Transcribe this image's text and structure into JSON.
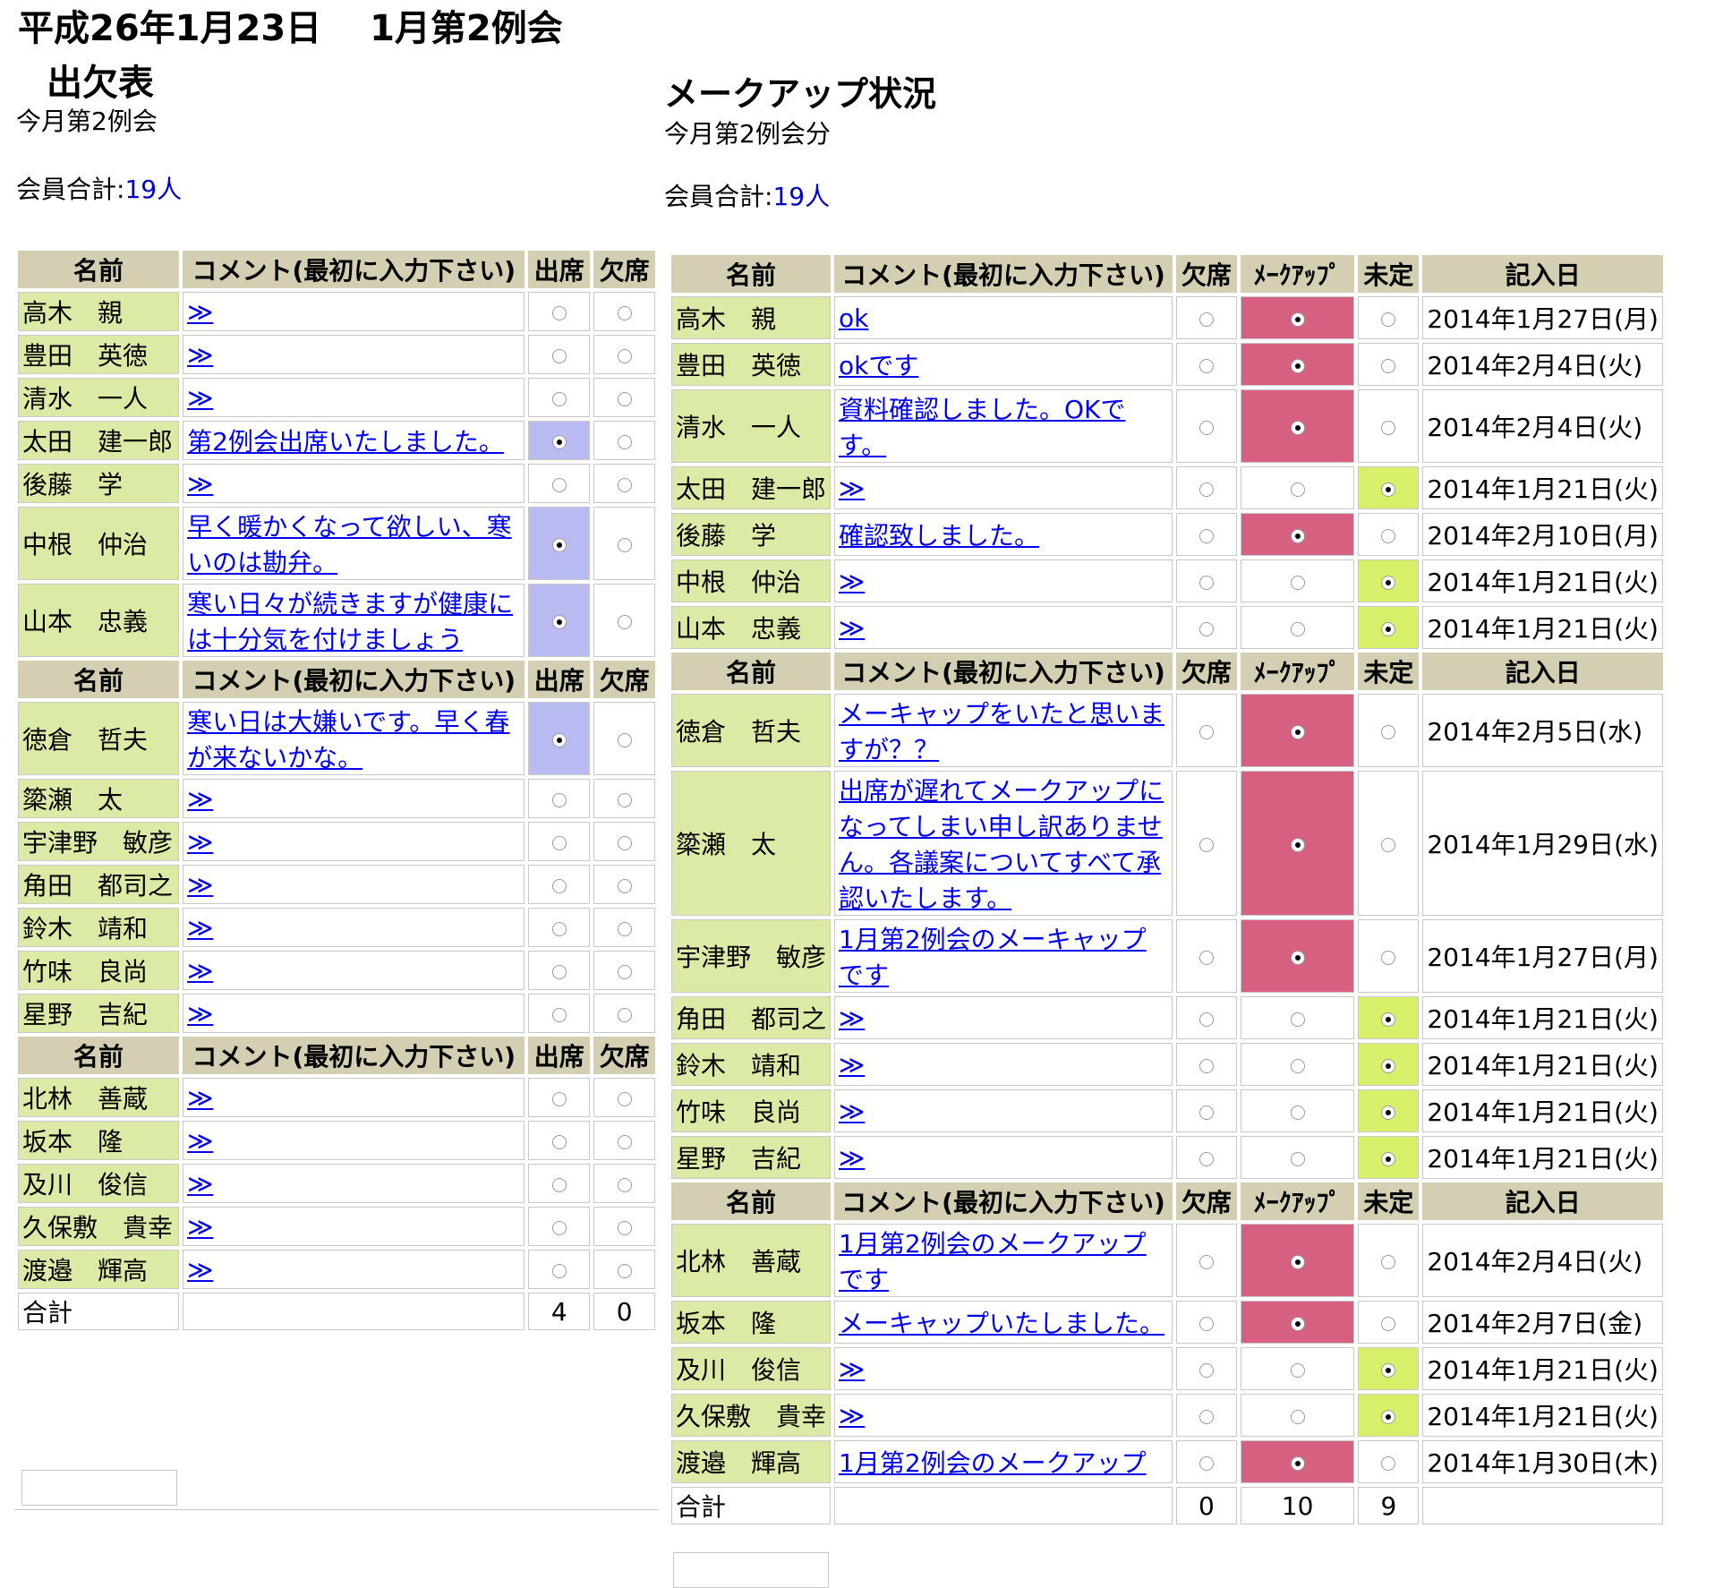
{
  "page_title": "平成26年1月23日　 1月第2例会",
  "left": {
    "title": "出欠表",
    "subtitle": "今月第2例会",
    "member_total_label": "会員合計:",
    "member_total_value": "19人",
    "headers": {
      "name": "名前",
      "comment": "コメント(最初に入力下さい)",
      "attend": "出席",
      "absent": "欠席"
    },
    "groups": [
      [
        {
          "name": "高木　親",
          "comment": "≫",
          "attend": false,
          "absent": false
        },
        {
          "name": "豊田　英徳",
          "comment": "≫",
          "attend": false,
          "absent": false
        },
        {
          "name": "清水　一人",
          "comment": "≫",
          "attend": false,
          "absent": false
        },
        {
          "name": "太田　建一郎",
          "comment": "第2例会出席いたしました。",
          "attend": true,
          "absent": false
        },
        {
          "name": "後藤　学",
          "comment": "≫",
          "attend": false,
          "absent": false
        },
        {
          "name": "中根　仲治",
          "comment": "早く暖かくなって欲しい、寒いのは勘弁。",
          "attend": true,
          "absent": false
        },
        {
          "name": "山本　忠義",
          "comment": "寒い日々が続きますが健康には十分気を付けましょう",
          "attend": true,
          "absent": false
        }
      ],
      [
        {
          "name": "徳倉　哲夫",
          "comment": "寒い日は大嫌いです。早く春が来ないかな。",
          "attend": true,
          "absent": false
        },
        {
          "name": "簗瀬　太",
          "comment": "≫",
          "attend": false,
          "absent": false
        },
        {
          "name": "宇津野　敏彦",
          "comment": "≫",
          "attend": false,
          "absent": false
        },
        {
          "name": "角田　都司之",
          "comment": "≫",
          "attend": false,
          "absent": false
        },
        {
          "name": "鈴木　靖和",
          "comment": "≫",
          "attend": false,
          "absent": false
        },
        {
          "name": "竹味　良尚",
          "comment": "≫",
          "attend": false,
          "absent": false
        },
        {
          "name": "星野　吉紀",
          "comment": "≫",
          "attend": false,
          "absent": false
        }
      ],
      [
        {
          "name": "北林　善蔵",
          "comment": "≫",
          "attend": false,
          "absent": false
        },
        {
          "name": "坂本　隆",
          "comment": "≫",
          "attend": false,
          "absent": false
        },
        {
          "name": "及川　俊信",
          "comment": "≫",
          "attend": false,
          "absent": false
        },
        {
          "name": "久保敷　貴幸",
          "comment": "≫",
          "attend": false,
          "absent": false
        },
        {
          "name": "渡邉　輝高",
          "comment": "≫",
          "attend": false,
          "absent": false
        }
      ]
    ],
    "total": {
      "label": "合計",
      "attend": "4",
      "absent": "0"
    }
  },
  "right": {
    "title": "メークアップ状況",
    "subtitle": "今月第2例会分",
    "member_total_label": "会員合計:",
    "member_total_value": "19人",
    "headers": {
      "name": "名前",
      "comment": "コメント(最初に入力下さい)",
      "absent": "欠席",
      "makeup": "ﾒｰｸｱｯﾌﾟ",
      "undecided": "未定",
      "date": "記入日"
    },
    "groups": [
      [
        {
          "name": "高木　親",
          "comment": "ok",
          "status": "makeup",
          "date": "2014年1月27日(月)"
        },
        {
          "name": "豊田　英徳",
          "comment": "okです",
          "status": "makeup",
          "date": "2014年2月4日(火)"
        },
        {
          "name": "清水　一人",
          "comment": "資料確認しました。OKです。",
          "status": "makeup",
          "date": "2014年2月4日(火)"
        },
        {
          "name": "太田　建一郎",
          "comment": "≫",
          "status": "undecided",
          "date": "2014年1月21日(火)"
        },
        {
          "name": "後藤　学",
          "comment": "確認致しました。",
          "status": "makeup",
          "date": "2014年2月10日(月)"
        },
        {
          "name": "中根　仲治",
          "comment": "≫",
          "status": "undecided",
          "date": "2014年1月21日(火)"
        },
        {
          "name": "山本　忠義",
          "comment": "≫",
          "status": "undecided",
          "date": "2014年1月21日(火)"
        }
      ],
      [
        {
          "name": "徳倉　哲夫",
          "comment": "メーキャップをいたと思いますが？？",
          "status": "makeup",
          "date": "2014年2月5日(水)"
        },
        {
          "name": "簗瀬　太",
          "comment": "出席が遅れてメークアップになってしまい申し訳ありません。各議案についてすべて承認いたします。",
          "status": "makeup",
          "date": "2014年1月29日(水)"
        },
        {
          "name": "宇津野　敏彦",
          "comment": "1月第2例会のメーキャップです",
          "status": "makeup",
          "date": "2014年1月27日(月)"
        },
        {
          "name": "角田　都司之",
          "comment": "≫",
          "status": "undecided",
          "date": "2014年1月21日(火)"
        },
        {
          "name": "鈴木　靖和",
          "comment": "≫",
          "status": "undecided",
          "date": "2014年1月21日(火)"
        },
        {
          "name": "竹味　良尚",
          "comment": "≫",
          "status": "undecided",
          "date": "2014年1月21日(火)"
        },
        {
          "name": "星野　吉紀",
          "comment": "≫",
          "status": "undecided",
          "date": "2014年1月21日(火)"
        }
      ],
      [
        {
          "name": "北林　善蔵",
          "comment": "1月第2例会のメークアップです",
          "status": "makeup",
          "date": "2014年2月4日(火)"
        },
        {
          "name": "坂本　隆",
          "comment": "メーキャップいたしました。",
          "status": "makeup",
          "date": "2014年2月7日(金)"
        },
        {
          "name": "及川　俊信",
          "comment": "≫",
          "status": "undecided",
          "date": "2014年1月21日(火)"
        },
        {
          "name": "久保敷　貴幸",
          "comment": "≫",
          "status": "undecided",
          "date": "2014年1月21日(火)"
        },
        {
          "name": "渡邉　輝高",
          "comment": "1月第2例会のメークアップ",
          "status": "makeup",
          "date": "2014年1月30日(木)"
        }
      ]
    ],
    "total": {
      "label": "合計",
      "absent": "0",
      "makeup": "10",
      "undecided": "9"
    }
  }
}
